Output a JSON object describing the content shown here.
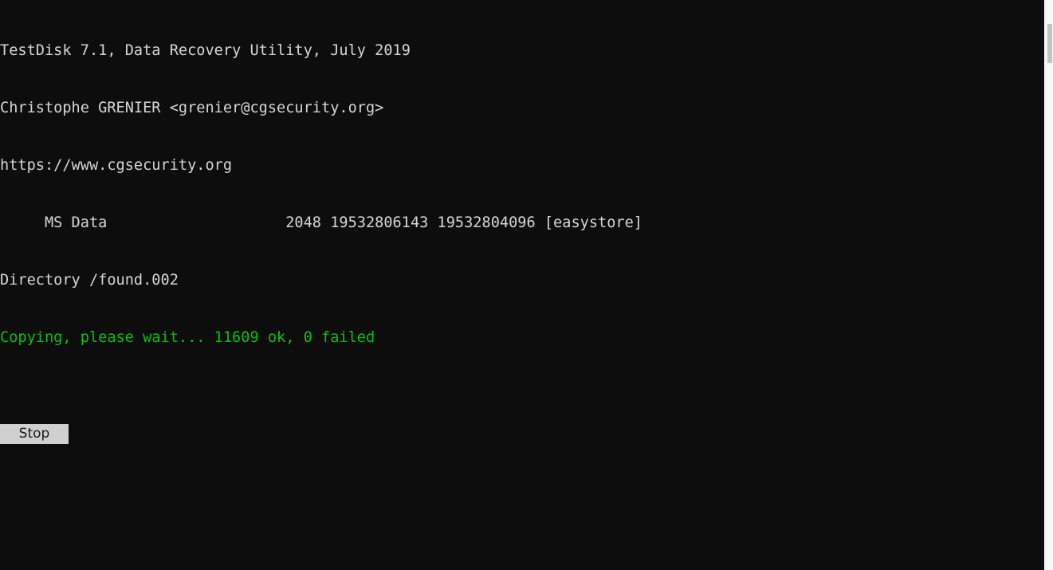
{
  "window": {
    "background_color": "#0d0d0d",
    "text_color": "#d6d6d6",
    "status_color": "#0bc00b",
    "scrollbar_track_color": "#f6f6f6",
    "scrollbar_thumb_color": "#c2c2c2"
  },
  "console": {
    "lines": [
      {
        "text": "TestDisk 7.1, Data Recovery Utility, July 2019",
        "style": "white"
      },
      {
        "text": "Christophe GRENIER <grenier@cgsecurity.org>",
        "style": "white"
      },
      {
        "text": "https://www.cgsecurity.org",
        "style": "white"
      },
      {
        "text": "     MS Data                    2048 19532806143 19532804096 [easystore]",
        "style": "white"
      },
      {
        "text": "Directory /found.002",
        "style": "white"
      },
      {
        "text": "Copying, please wait... 11609 ok, 0 failed",
        "style": "green"
      }
    ],
    "header": {
      "app_title": "TestDisk 7.1, Data Recovery Utility, July 2019",
      "author": "Christophe GRENIER <grenier@cgsecurity.org>",
      "website": "https://www.cgsecurity.org"
    },
    "partition": {
      "type": "MS Data",
      "start_sector": "2048",
      "end_sector": "19532806143",
      "size_sectors": "19532804096",
      "label": "[easystore]"
    },
    "directory": "Directory /found.002",
    "status": {
      "message": "Copying, please wait...",
      "ok_count": "11609",
      "ok_label": "ok,",
      "failed_count": "0",
      "failed_label": "failed",
      "full_text": "Copying, please wait... 11609 ok, 0 failed"
    }
  },
  "controls": {
    "stop_label": "Stop"
  }
}
